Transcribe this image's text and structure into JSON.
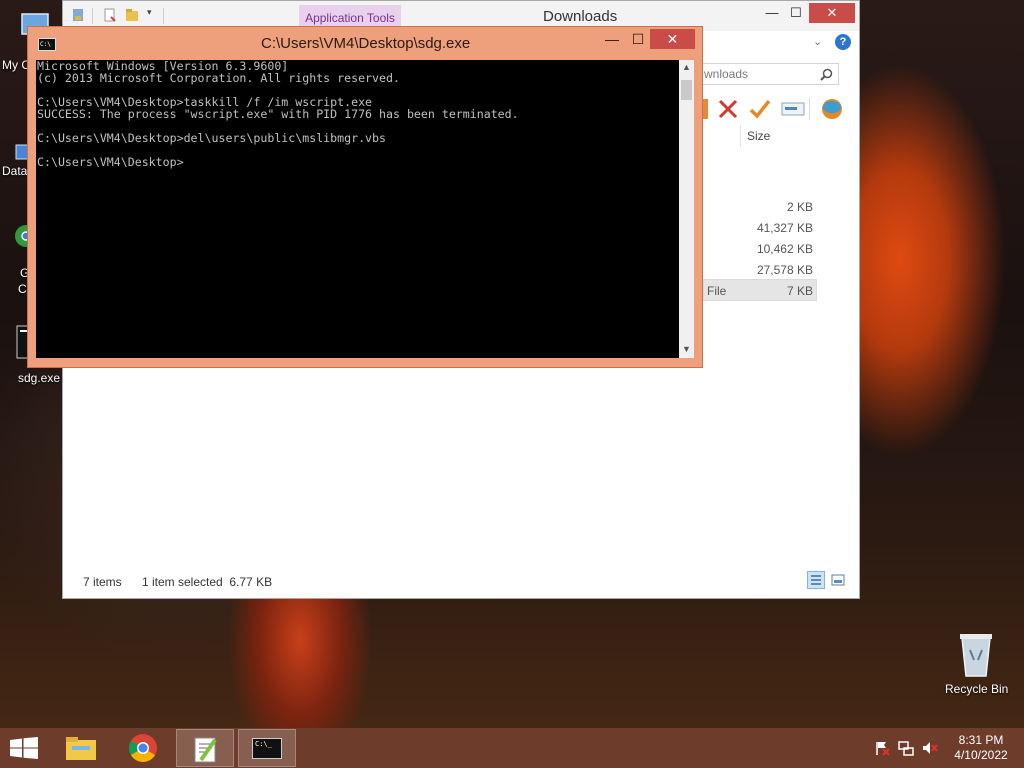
{
  "desktop": {
    "icons": [
      {
        "label": "My C"
      },
      {
        "label": "Data"
      },
      {
        "label": "G"
      },
      {
        "label": "C"
      },
      {
        "label": "sdg.exe"
      },
      {
        "label": "Recycle Bin"
      }
    ]
  },
  "explorer": {
    "title": "Downloads",
    "app_tools": "Application Tools",
    "search_placeholder": "wnloads",
    "size_header": "Size",
    "rows": [
      {
        "type": "",
        "size": "2 KB"
      },
      {
        "type": "",
        "size": "41,327 KB"
      },
      {
        "type": "",
        "size": "10,462 KB"
      },
      {
        "type": "",
        "size": "27,578 KB"
      },
      {
        "type": "File",
        "size": "7 KB",
        "selected": true
      }
    ],
    "status_items": "7 items",
    "status_selected": "1 item selected  6.77 KB",
    "min_glyph": "—",
    "max_glyph": "☐",
    "close_glyph": "✕"
  },
  "console": {
    "title": "C:\\Users\\VM4\\Desktop\\sdg.exe",
    "icon_text": "C:\\",
    "lines": [
      "Microsoft Windows [Version 6.3.9600]",
      "(c) 2013 Microsoft Corporation. All rights reserved.",
      "",
      "C:\\Users\\VM4\\Desktop>taskkill /f /im wscript.exe",
      "SUCCESS: The process \"wscript.exe\" with PID 1776 has been terminated.",
      "",
      "C:\\Users\\VM4\\Desktop>del\\users\\public\\mslibmgr.vbs",
      "",
      "C:\\Users\\VM4\\Desktop>"
    ],
    "min_glyph": "—",
    "max_glyph": "☐",
    "close_glyph": "✕"
  },
  "taskbar": {
    "time": "8:31 PM",
    "date": "4/10/2022",
    "console_thumb_text": "C:\\_"
  },
  "colors": {
    "console_frame": "#ee9f7b",
    "close_red": "#c94c48",
    "taskbar": "#6d3c2a"
  }
}
